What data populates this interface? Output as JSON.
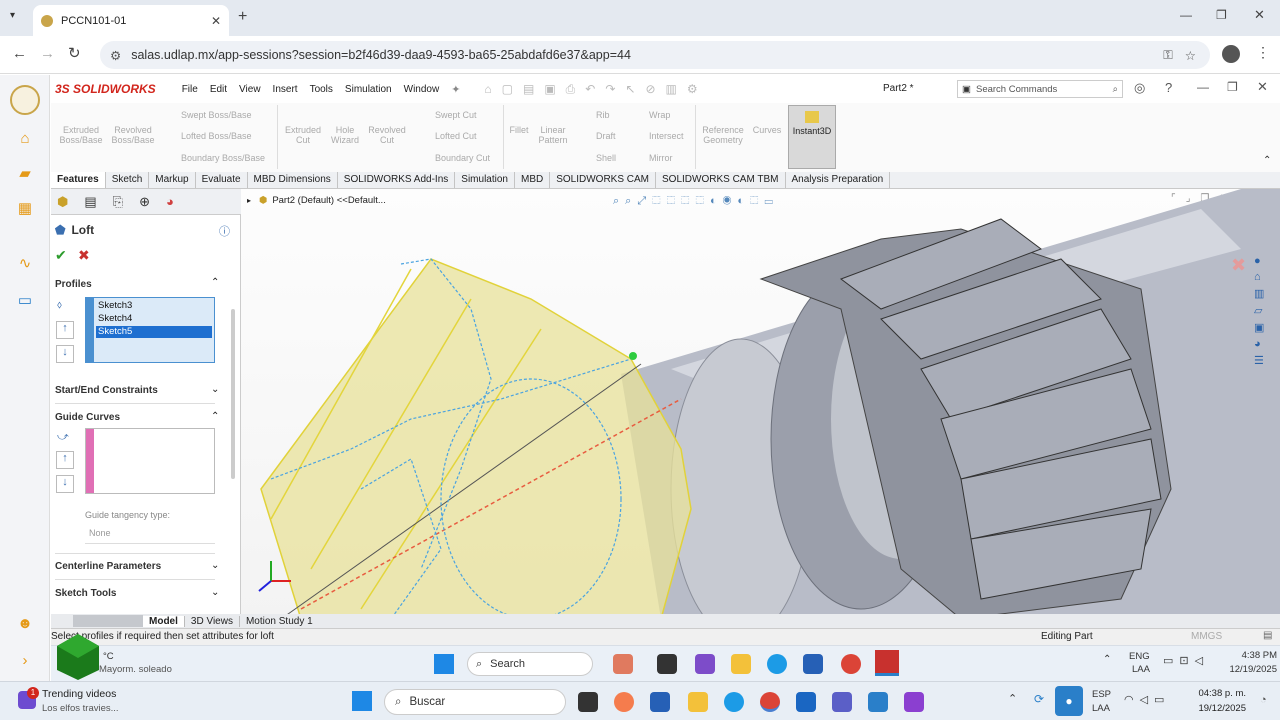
{
  "browser": {
    "tab_title": "PCCN101-01",
    "url": "salas.udlap.mx/app-sessions?session=b2f46d39-daa9-4593-ba65-25abdafd6e37&app=44"
  },
  "solidworks": {
    "logo": "3S SOLIDWORKS",
    "menu": [
      "File",
      "Edit",
      "View",
      "Insert",
      "Tools",
      "Simulation",
      "Window"
    ],
    "doc_title": "Part2 *",
    "search_placeholder": "Search Commands",
    "ribbon": {
      "extruded_boss": "Extruded Boss/Base",
      "revolved_boss": "Revolved Boss/Base",
      "swept_boss": "Swept Boss/Base",
      "lofted_boss": "Lofted Boss/Base",
      "boundary_boss": "Boundary Boss/Base",
      "extruded_cut": "Extruded Cut",
      "hole_wizard": "Hole Wizard",
      "revolved_cut": "Revolved Cut",
      "swept_cut": "Swept Cut",
      "lofted_cut": "Lofted Cut",
      "boundary_cut": "Boundary Cut",
      "fillet": "Fillet",
      "linear_pattern": "Linear Pattern",
      "rib": "Rib",
      "draft": "Draft",
      "shell": "Shell",
      "wrap": "Wrap",
      "intersect": "Intersect",
      "mirror": "Mirror",
      "reference_geometry": "Reference Geometry",
      "curves": "Curves",
      "instant3d": "Instant3D"
    },
    "command_tabs": [
      "Features",
      "Sketch",
      "Markup",
      "Evaluate",
      "MBD Dimensions",
      "SOLIDWORKS Add-Ins",
      "Simulation",
      "MBD",
      "SOLIDWORKS CAM",
      "SOLIDWORKS CAM TBM",
      "Analysis Preparation"
    ],
    "property_manager": {
      "title": "Loft",
      "profiles_header": "Profiles",
      "profiles": [
        "Sketch3",
        "Sketch4",
        "Sketch5"
      ],
      "start_end": "Start/End Constraints",
      "guide_curves": "Guide Curves",
      "guide_tangency_label": "Guide tangency type:",
      "guide_tangency_value": "None",
      "centerline": "Centerline Parameters",
      "sketch_tools": "Sketch Tools"
    },
    "tree_label": "Part2 (Default) <<Default...",
    "bottom_tabs": [
      "Model",
      "3D Views",
      "Motion Study 1"
    ],
    "status_left": "Select profiles if required then set attributes for loft",
    "status_mid": "Editing Part",
    "status_units": "MMGS"
  },
  "taskbar_remote": {
    "weather_line1": "°C",
    "weather_line2": "Mayorm. soleado",
    "search": "Search",
    "lang1": "ENG",
    "lang2": "LAA",
    "time": "4:38 PM",
    "date": "12/19/2025"
  },
  "taskbar_local": {
    "news_title": "Trending videos",
    "news_sub": "Los elfos travies...",
    "news_badge": "1",
    "search": "Buscar",
    "lang1": "ESP",
    "lang2": "LAA",
    "time": "04:38 p. m.",
    "date": "19/12/2025"
  }
}
